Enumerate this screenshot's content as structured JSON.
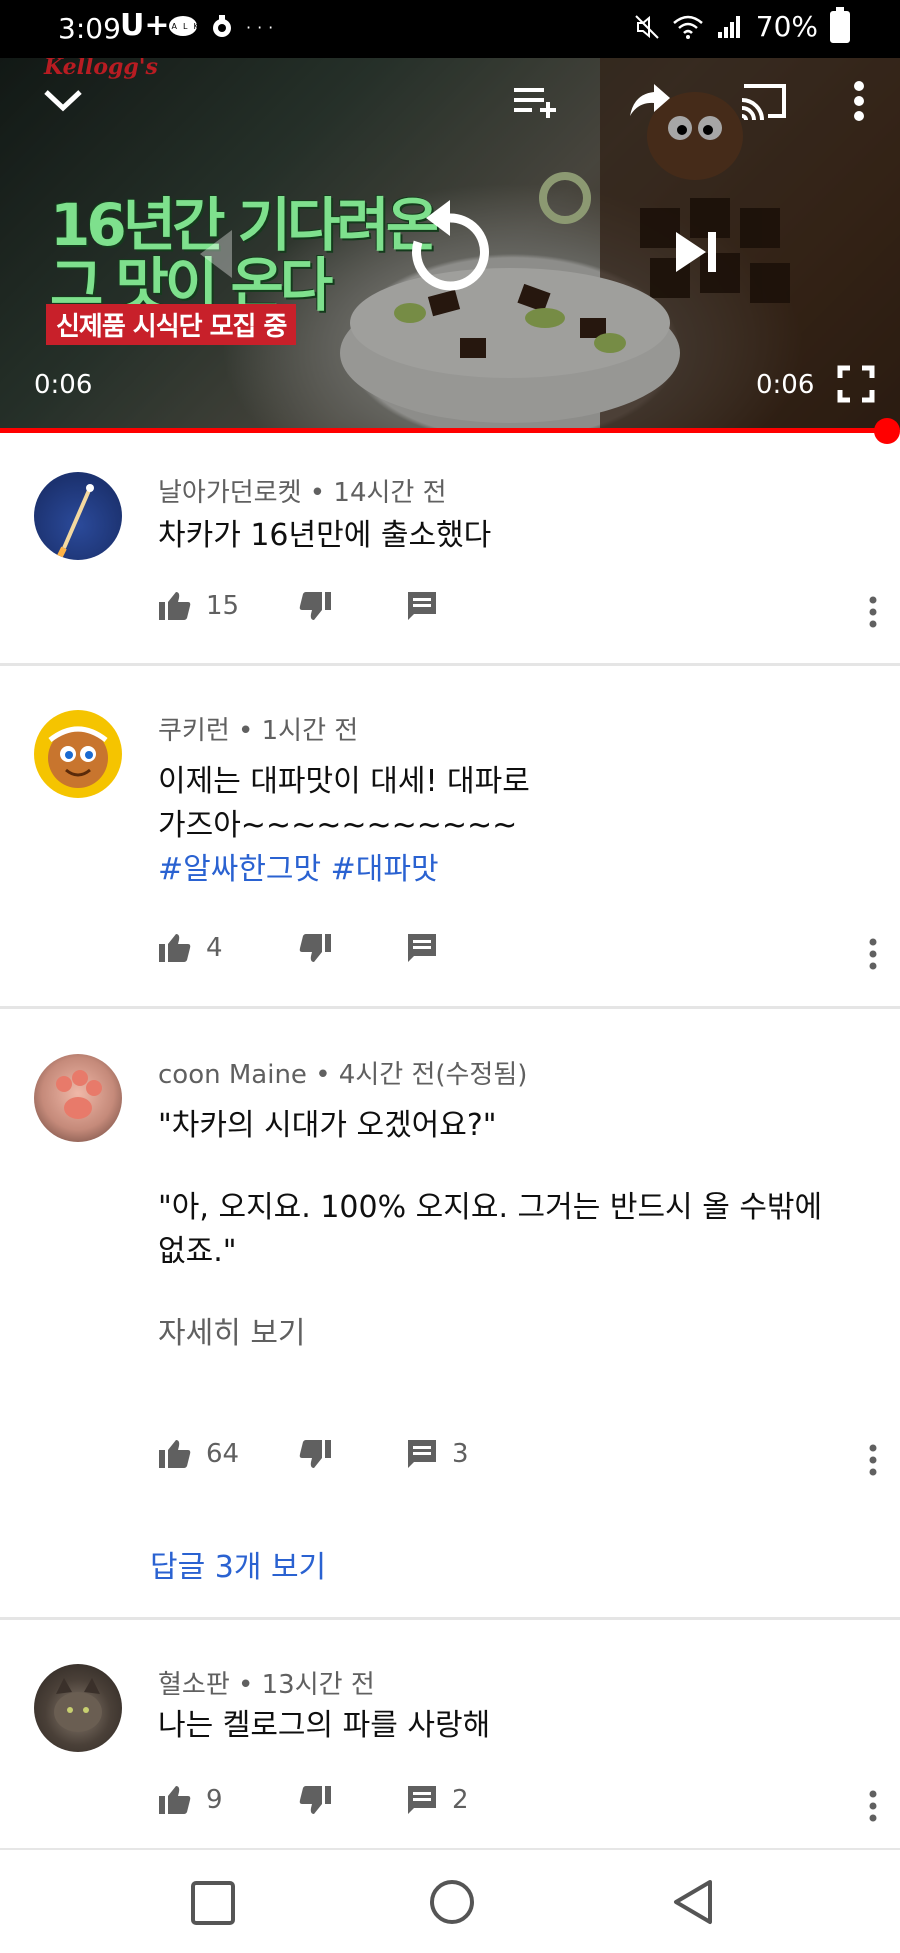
{
  "status_bar": {
    "time": "3:09",
    "carrier": "U+",
    "notification_icons": "talk-icon, location-icon",
    "more_indicator": "···",
    "battery": "70%"
  },
  "player": {
    "brand_logo": "Kellogg's",
    "overlay_title_line1": "16년간 기다려온",
    "overlay_title_line2": "그 맛이 온다",
    "overlay_banner": "신제품 시식단 모집 중",
    "current_time": "0:06",
    "duration": "0:06",
    "progress": 1.0,
    "accent": "#ff0000"
  },
  "comments": [
    {
      "author": "날아가던로켓",
      "age": "14시간 전",
      "text": "차카가 16년만에 출소했다",
      "likes": "15",
      "replies": ""
    },
    {
      "author": "쿠키런",
      "age": "1시간 전",
      "text_line1": "이제는 대파맛이 대세! 대파로",
      "text_line2": "가즈아~~~~~~~~~~~",
      "hashtags": "#알싸한그맛 #대파맛",
      "likes": "4",
      "replies": ""
    },
    {
      "author": "coon Maine",
      "age": "4시간 전(수정됨)",
      "text_line1": "\"차카의 시대가 오겠어요?\"",
      "text_line2": "\"아, 오지요. 100% 오지요. 그거는 반드시 올 수밖에",
      "text_line3": "없죠.\"",
      "read_more": "자세히 보기",
      "likes": "64",
      "replies": "3",
      "view_replies": "답글 3개 보기"
    },
    {
      "author": "혈소판",
      "age": "13시간 전",
      "text": "나는 켈로그의 파를 사랑해",
      "likes": "9",
      "replies": "2"
    }
  ],
  "meta_separator": "•",
  "colors": {
    "link": "#2a62d1",
    "secondary_text": "#606060",
    "accent": "#ff0000"
  },
  "icons": [
    "chevron-down-icon",
    "add-to-queue-icon",
    "share-icon",
    "cast-icon",
    "more-vert-icon",
    "replay-icon",
    "skip-next-icon",
    "fullscreen-icon",
    "thumb-up-icon",
    "thumb-down-icon",
    "comment-icon",
    "nav-recents-icon",
    "nav-home-icon",
    "nav-back-icon"
  ]
}
